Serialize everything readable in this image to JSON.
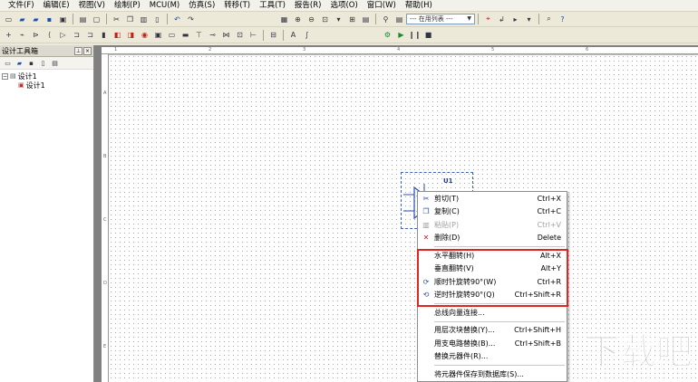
{
  "menubar": {
    "items": [
      "文件(F)",
      "编辑(E)",
      "视图(V)",
      "绘制(P)",
      "MCU(M)",
      "仿真(S)",
      "转移(T)",
      "工具(T)",
      "报告(R)",
      "选项(O)",
      "窗口(W)",
      "帮助(H)"
    ]
  },
  "toolbar": {
    "list_combo_value": "--- 在用列表 ---"
  },
  "design_panel": {
    "title": "设计工具箱",
    "tree": [
      {
        "label": "设计1",
        "expanded": true
      },
      {
        "label": "设计1"
      }
    ]
  },
  "rulers": {
    "top": [
      "1",
      "2",
      "3",
      "4",
      "5",
      "6"
    ],
    "left": [
      "A",
      "B",
      "C",
      "D",
      "E"
    ]
  },
  "component": {
    "ref": "U1"
  },
  "context_menu": {
    "items": [
      {
        "label": "剪切(T)",
        "shortcut": "Ctrl+X",
        "icon": "scissors-icon",
        "enabled": true
      },
      {
        "label": "复制(C)",
        "shortcut": "Ctrl+C",
        "icon": "copy-icon",
        "enabled": true
      },
      {
        "label": "粘贴(P)",
        "shortcut": "Ctrl+V",
        "icon": "paste-icon",
        "enabled": false
      },
      {
        "label": "删除(D)",
        "shortcut": "Delete",
        "icon": "delete-icon",
        "enabled": true
      },
      {
        "label": "水平翻转(H)",
        "shortcut": "Alt+X",
        "icon": "",
        "enabled": true
      },
      {
        "label": "垂直翻转(V)",
        "shortcut": "Alt+Y",
        "icon": "",
        "enabled": true
      },
      {
        "label": "顺时针旋转90°(W)",
        "shortcut": "Ctrl+R",
        "icon": "rotate-cw-icon",
        "enabled": true
      },
      {
        "label": "逆时针旋转90°(Q)",
        "shortcut": "Ctrl+Shift+R",
        "icon": "rotate-ccw-icon",
        "enabled": true
      },
      {
        "label": "总线向量连接...",
        "shortcut": "",
        "icon": "",
        "enabled": true
      },
      {
        "label": "用层次块替换(Y)...",
        "shortcut": "Ctrl+Shift+H",
        "icon": "",
        "enabled": true
      },
      {
        "label": "用支电路替换(B)...",
        "shortcut": "Ctrl+Shift+B",
        "icon": "",
        "enabled": true
      },
      {
        "label": "替换元器件(R)...",
        "shortcut": "",
        "icon": "",
        "enabled": true
      },
      {
        "label": "将元器件保存到数据库(S)...",
        "shortcut": "",
        "icon": "",
        "enabled": true
      }
    ]
  },
  "watermark": {
    "text": "下载吧"
  },
  "colors": {
    "highlight": "#e0261f",
    "selection": "#3d5fc8"
  }
}
